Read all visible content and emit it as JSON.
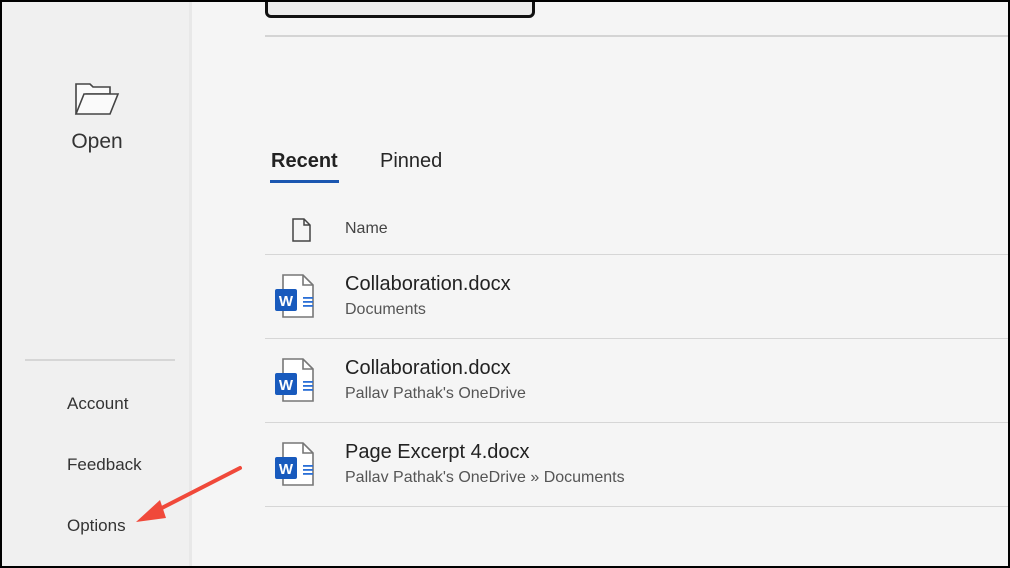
{
  "sidebar": {
    "open_label": "Open",
    "items": [
      {
        "label": "Account"
      },
      {
        "label": "Feedback"
      },
      {
        "label": "Options"
      }
    ]
  },
  "tabs": [
    {
      "label": "Recent",
      "active": true
    },
    {
      "label": "Pinned",
      "active": false
    }
  ],
  "list": {
    "header_name": "Name",
    "files": [
      {
        "name": "Collaboration.docx",
        "location": "Documents"
      },
      {
        "name": "Collaboration.docx",
        "location": "Pallav Pathak's OneDrive"
      },
      {
        "name": "Page Excerpt 4.docx",
        "location": "Pallav Pathak's OneDrive » Documents"
      }
    ]
  },
  "colors": {
    "accent": "#1a56b0",
    "word_blue": "#185abd",
    "arrow": "#f0493a"
  }
}
